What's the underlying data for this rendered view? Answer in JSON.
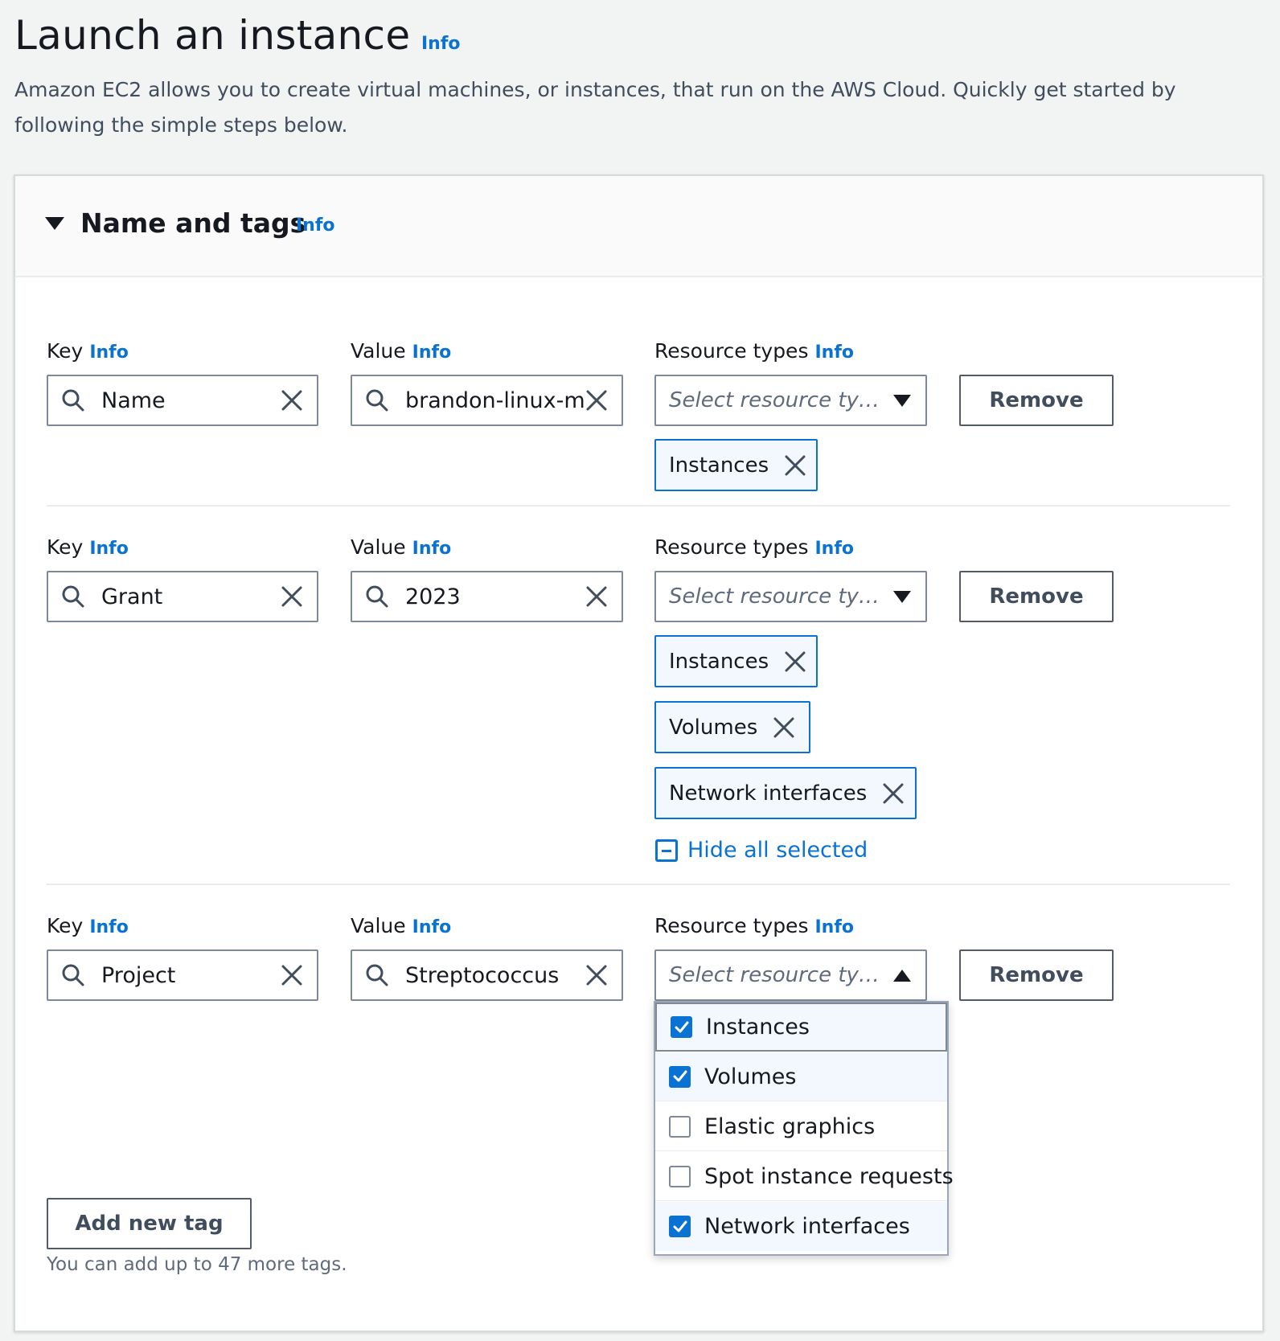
{
  "header": {
    "title": "Launch an instance",
    "info": "Info",
    "description": "Amazon EC2 allows you to create virtual machines, or instances, that run on the AWS Cloud. Quickly get started by following the simple steps below."
  },
  "section": {
    "title": "Name and tags",
    "info": "Info"
  },
  "labels": {
    "key": "Key",
    "value": "Value",
    "resource_types": "Resource types",
    "info": "Info",
    "select_placeholder": "Select resource ty…",
    "remove": "Remove"
  },
  "tags": [
    {
      "key": "Name",
      "value": "brandon-linux-m",
      "tokens": [
        "Instances"
      ]
    },
    {
      "key": "Grant",
      "value": "2023",
      "tokens": [
        "Instances",
        "Volumes",
        "Network interfaces"
      ]
    },
    {
      "key": "Project",
      "value": "Streptococcus",
      "tokens": []
    }
  ],
  "hide_all_selected": "Hide all selected",
  "dropdown_options": [
    {
      "label": "Instances",
      "checked": true
    },
    {
      "label": "Volumes",
      "checked": true
    },
    {
      "label": "Elastic graphics",
      "checked": false
    },
    {
      "label": "Spot instance requests",
      "checked": false
    },
    {
      "label": "Network interfaces",
      "checked": true
    }
  ],
  "add_tag_button": "Add new tag",
  "add_tag_hint": "You can add up to 47 more tags.",
  "colors": {
    "accent": "#0972d3",
    "text": "#16191f",
    "border": "#7d8998",
    "token_bg": "#f2f8fd"
  },
  "icons": {
    "search": "search-icon",
    "clear": "close-icon",
    "caret": "caret-down-icon",
    "check": "check-icon",
    "minus": "minus-square-icon"
  }
}
